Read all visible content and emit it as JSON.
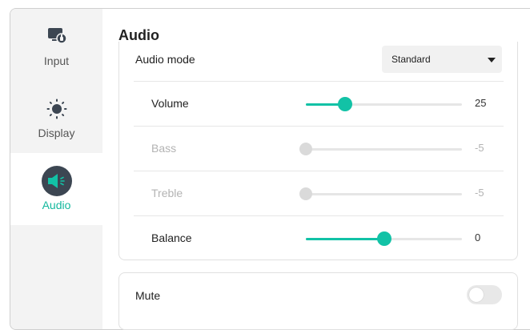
{
  "sidebar": {
    "items": [
      {
        "label": "Input",
        "icon": "input-source-icon",
        "active": false
      },
      {
        "label": "Display",
        "icon": "brightness-icon",
        "active": false
      },
      {
        "label": "Audio",
        "icon": "speaker-icon",
        "active": true
      }
    ]
  },
  "page": {
    "title": "Audio"
  },
  "audio_mode": {
    "label": "Audio mode",
    "value": "Standard"
  },
  "sliders": [
    {
      "label": "Volume",
      "value": "25",
      "level": 0.25,
      "enabled": true
    },
    {
      "label": "Bass",
      "value": "-5",
      "level": 0.0,
      "enabled": false
    },
    {
      "label": "Treble",
      "value": "-5",
      "level": 0.0,
      "enabled": false
    },
    {
      "label": "Balance",
      "value": "0",
      "level": 0.5,
      "enabled": true
    }
  ],
  "mute": {
    "label": "Mute",
    "on": false
  },
  "colors": {
    "accent": "#12c2a6",
    "active_text": "#12b89d",
    "sidebar_bg": "#f3f3f3",
    "icon_dark": "#3c4652"
  }
}
